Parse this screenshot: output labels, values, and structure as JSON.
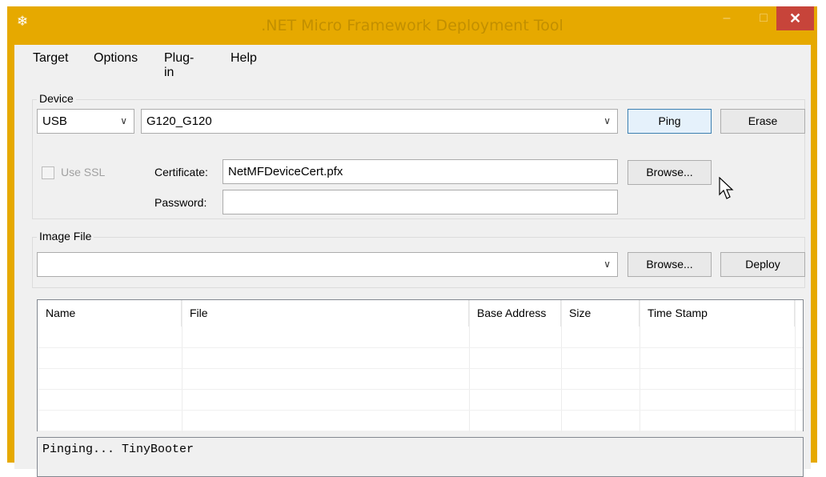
{
  "window": {
    "title": ".NET Micro Framework Deployment Tool",
    "app_icon": "snowflake-icon",
    "minimize_glyph": "–",
    "maximize_glyph": "□",
    "close_glyph": "✕",
    "accent": "#e6a900",
    "close_color": "#c7443a"
  },
  "menu": {
    "items": [
      "Target",
      "Options",
      "Plug-in",
      "Help"
    ]
  },
  "device": {
    "group_label": "Device",
    "transport": "USB",
    "device_name": "G120_G120",
    "ping_label": "Ping",
    "erase_label": "Erase",
    "use_ssl_label": "Use SSL",
    "certificate_label": "Certificate:",
    "certificate_value": "NetMFDeviceCert.pfx",
    "browse_label": "Browse...",
    "password_label": "Password:",
    "password_value": ""
  },
  "image_file": {
    "group_label": "Image File",
    "value": "",
    "browse_label": "Browse...",
    "deploy_label": "Deploy"
  },
  "table": {
    "columns": [
      "Name",
      "File",
      "Base Address",
      "Size",
      "Time Stamp"
    ],
    "rows": []
  },
  "output": {
    "text": "Pinging... TinyBooter"
  }
}
